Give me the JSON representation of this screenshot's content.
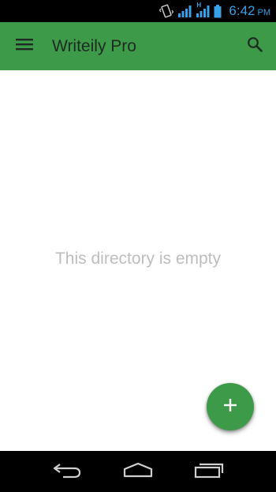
{
  "status_bar": {
    "time": "6:42",
    "ampm": "PM",
    "network_type": "H",
    "icons": [
      "vibrate-icon",
      "signal-icon",
      "signal-h-icon",
      "battery-icon"
    ]
  },
  "app_bar": {
    "title": "Writeily Pro",
    "menu_icon": "hamburger-menu-icon",
    "search_icon": "search-icon"
  },
  "content": {
    "empty_message": "This directory is empty"
  },
  "fab": {
    "icon": "plus-icon"
  },
  "nav_bar": {
    "icons": [
      "back-icon",
      "home-icon",
      "recent-apps-icon"
    ]
  },
  "colors": {
    "primary": "#3d9a48",
    "status_accent": "#3aa0e8",
    "empty_text": "#bdbdbd"
  }
}
